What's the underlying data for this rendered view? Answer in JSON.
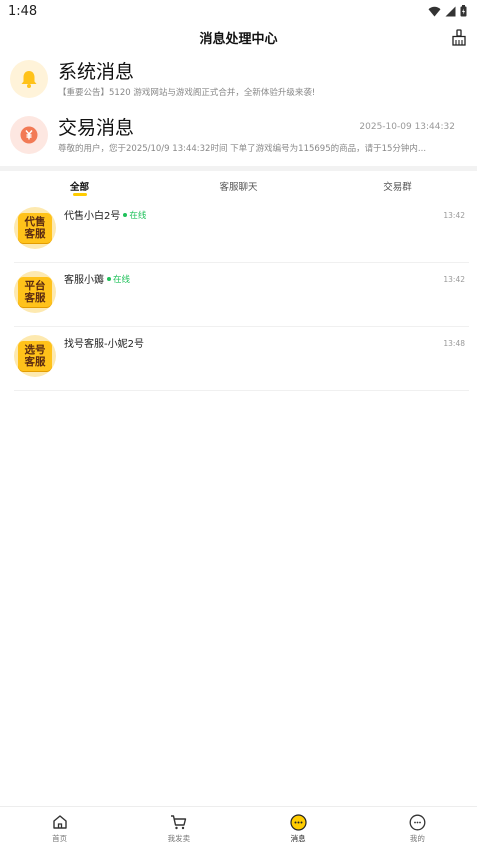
{
  "status_bar": {
    "time": "1:48"
  },
  "header": {
    "title": "消息处理中心",
    "clean_icon": "broom-icon"
  },
  "system_message": {
    "title": "系统消息",
    "description": "【重要公告】5120 游戏网站与游戏阁正式合并，全新体验升级来袭!",
    "icon": "bell-icon",
    "color": "#ffcc33"
  },
  "trade_message": {
    "title": "交易消息",
    "time": "2025-10-09 13:44:32",
    "description": "尊敬的用户，您于2025/10/9 13:44:32时间 下单了游戏编号为115695的商品，请于15分钟内...",
    "icon": "yen-coin-icon",
    "color": "#f06e4a"
  },
  "tabs": [
    {
      "label": "全部",
      "active": true
    },
    {
      "label": "客服聊天",
      "active": false
    },
    {
      "label": "交易群",
      "active": false
    }
  ],
  "chats": [
    {
      "name": "代售小白2号",
      "online": true,
      "status": "在线",
      "time": "13:42",
      "avatar_line1": "代售",
      "avatar_line2": "客服"
    },
    {
      "name": "客服小薅",
      "online": true,
      "status": "在线",
      "time": "13:42",
      "avatar_line1": "平台",
      "avatar_line2": "客服"
    },
    {
      "name": "找号客服-小妮2号",
      "online": false,
      "status": "",
      "time": "13:48",
      "avatar_line1": "选号",
      "avatar_line2": "客服"
    }
  ],
  "bottom_nav": [
    {
      "label": "首页",
      "icon": "home-icon",
      "active": false
    },
    {
      "label": "我发卖",
      "icon": "cart-icon",
      "active": false
    },
    {
      "label": "消息",
      "icon": "message-icon",
      "active": true
    },
    {
      "label": "我的",
      "icon": "profile-icon",
      "active": false
    }
  ],
  "colors": {
    "accent": "#ffcc00",
    "online": "#1fc15a"
  }
}
